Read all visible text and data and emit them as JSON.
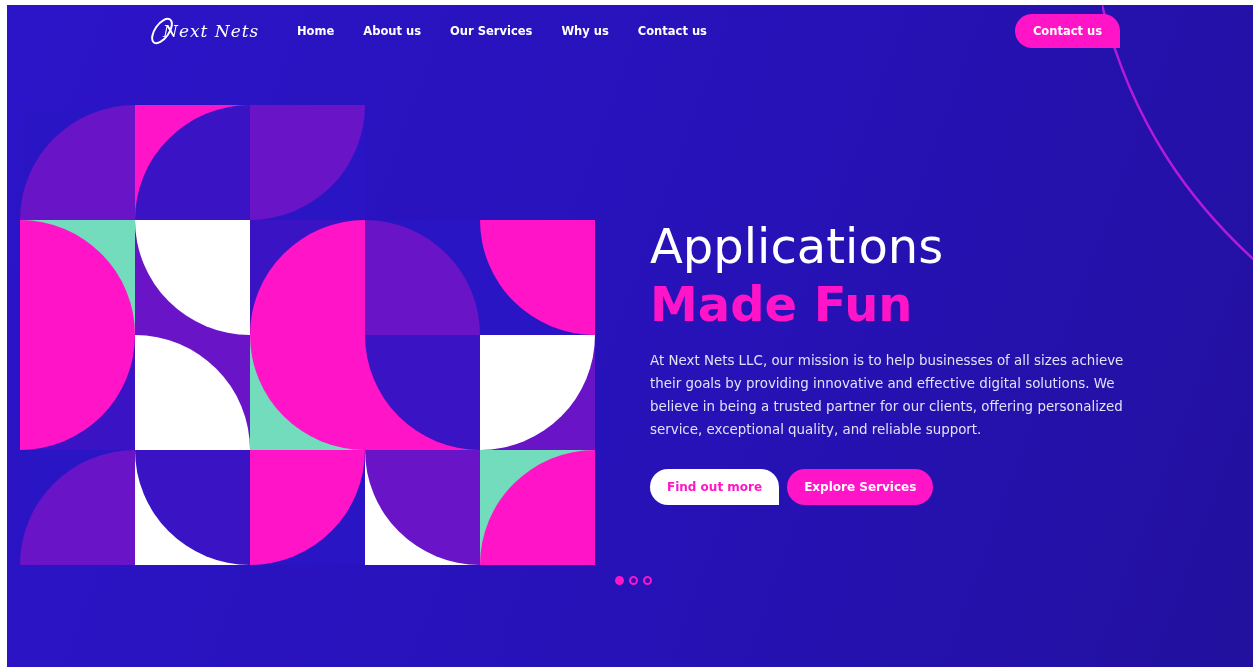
{
  "logo": {
    "text": "Next Nets"
  },
  "nav": {
    "links": [
      "Home",
      "About us",
      "Our Services",
      "Why us",
      "Contact us"
    ]
  },
  "header_button": {
    "label": "Contact us"
  },
  "hero": {
    "title_line_1": "Applications",
    "title_line_2": "Made Fun",
    "description": "At Next Nets LLC, our mission is to help businesses of all sizes achieve their goals by providing innovative and effective digital solutions. We believe in being a trusted partner for our clients, offering personalized service, exceptional quality, and reliable support.",
    "buttons": [
      {
        "label": "Find out more",
        "kind": "secondary"
      },
      {
        "label": "Explore Services",
        "kind": "primary"
      }
    ]
  },
  "carousel": {
    "dots": [
      {
        "selected": true
      },
      {
        "selected": false
      },
      {
        "selected": false
      }
    ]
  }
}
